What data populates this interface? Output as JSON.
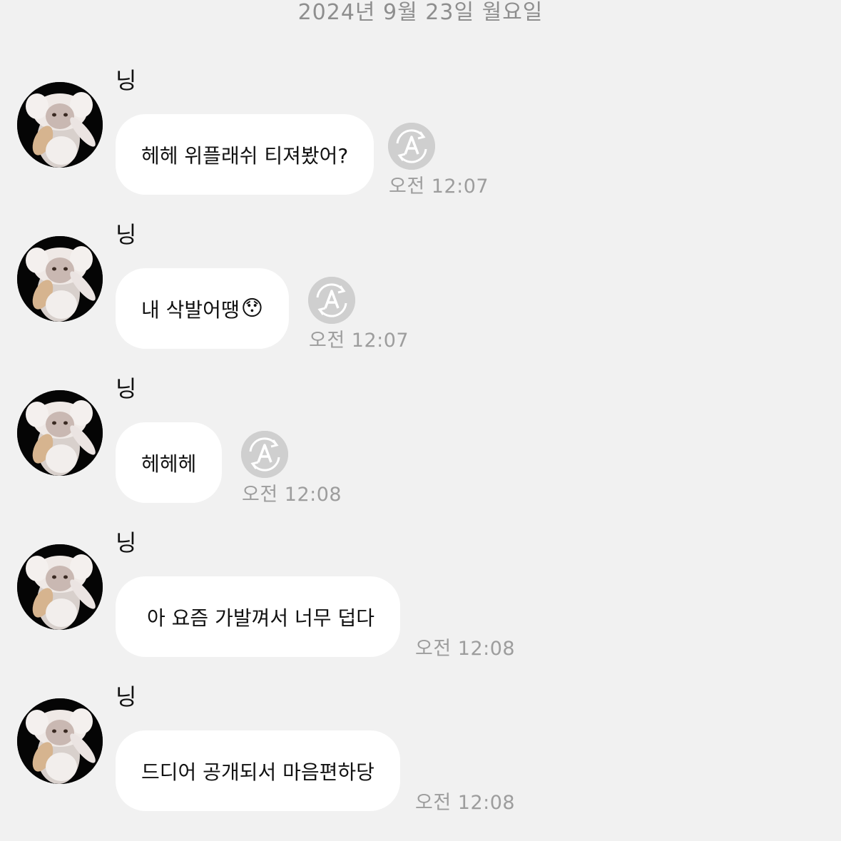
{
  "date_header": "2024년 9월 23일 월요일",
  "messages": [
    {
      "sender": "닝",
      "text": "헤헤 위플래쉬 티져봤어?",
      "emoji": "",
      "time": "오전 12:07",
      "translate": true
    },
    {
      "sender": "닝",
      "text": "내 삭발어땡",
      "emoji": "😯",
      "time": "오전 12:07",
      "translate": true
    },
    {
      "sender": "닝",
      "text": "헤헤헤",
      "emoji": "",
      "time": "오전 12:08",
      "translate": true
    },
    {
      "sender": "닝",
      "text": "아 요즘 가발껴서 너무 덥다",
      "emoji": "",
      "time": "오전 12:08",
      "translate": false
    },
    {
      "sender": "닝",
      "text": "드디어 공개되서 마음편하당",
      "emoji": "",
      "time": "오전 12:08",
      "translate": false
    }
  ],
  "icons": {
    "avatar": "fluffy-white-cat-avatar",
    "translate": "auto-translate-icon"
  },
  "colors": {
    "background": "#f1f1f1",
    "bubble": "#ffffff",
    "text": "#111111",
    "meta_text": "#9d9d9d",
    "translate_icon": "#cfcfcf"
  }
}
